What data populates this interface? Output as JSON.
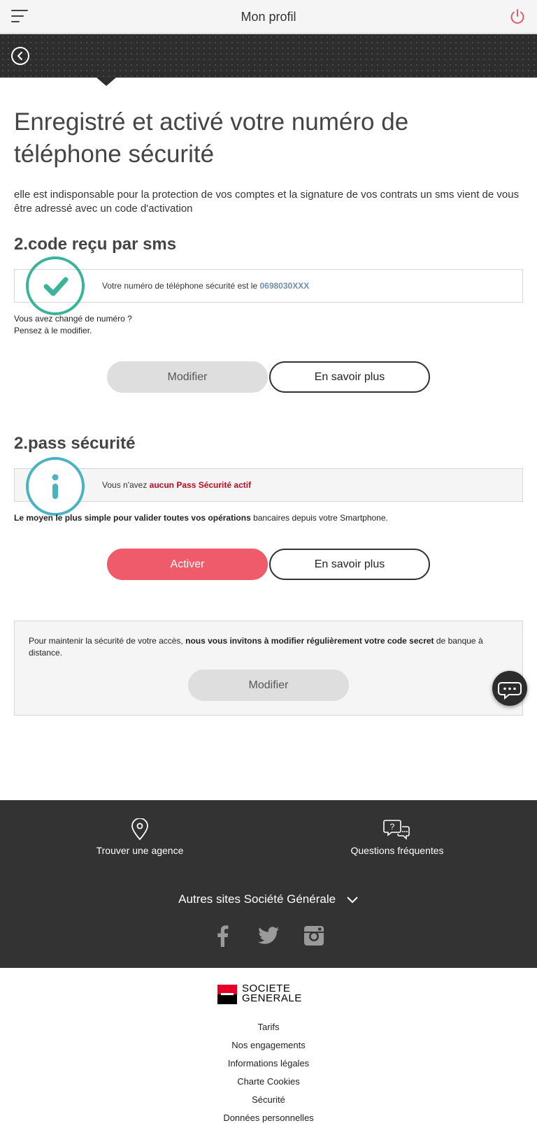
{
  "header": {
    "title": "Mon profil"
  },
  "main": {
    "title": "Enregistré et activé votre numéro de téléphone sécurité",
    "intro": "elle est indisponsable pour la protection de vos comptes et la signature de vos contrats un sms vient de vous être adressé avec un code d'activation"
  },
  "sms_section": {
    "title": "2.code reçu par sms",
    "box_text": "Votre numéro de téléphone sécurité est le ",
    "phone_number": "0698030XXX",
    "changed_line1": "Vous avez changé de numéro ?",
    "changed_line2": "Pensez à le modifier.",
    "modify_label": "Modifier",
    "learn_more_label": "En savoir plus"
  },
  "pass_section": {
    "title": "2.pass sécurité",
    "box_text_prefix": "Vous n'avez ",
    "box_text_bold": "aucun Pass Sécurité actif",
    "desc_bold": "Le moyen le plus simple pour valider toutes vos opérations",
    "desc_rest": " bancaires depuis votre Smartphone.",
    "activate_label": "Activer",
    "learn_more_label": "En savoir plus"
  },
  "secret_code": {
    "text_prefix": "Pour maintenir la sécurité de votre accès, ",
    "text_bold": "nous vous invitons à modifier régulièrement votre code secret",
    "text_suffix": " de banque à distance.",
    "modify_label": "Modifier"
  },
  "footer": {
    "find_agency": "Trouver une agence",
    "faq": "Questions fréquentes",
    "other_sites": "Autres sites Société Générale",
    "social": [
      "facebook-icon",
      "twitter-icon",
      "instagram-icon"
    ]
  },
  "bottom": {
    "logo_line1": "SOCIETE",
    "logo_line2": "GENERALE",
    "links": [
      "Tarifs",
      "Nos engagements",
      "Informations légales",
      "Charte Cookies",
      "Sécurité",
      "Données personnelles"
    ]
  },
  "colors": {
    "accent_red": "#ef5b6b",
    "success_green": "#3ab39a",
    "info_blue": "#4bb2c3",
    "footer_dark": "#333333"
  }
}
